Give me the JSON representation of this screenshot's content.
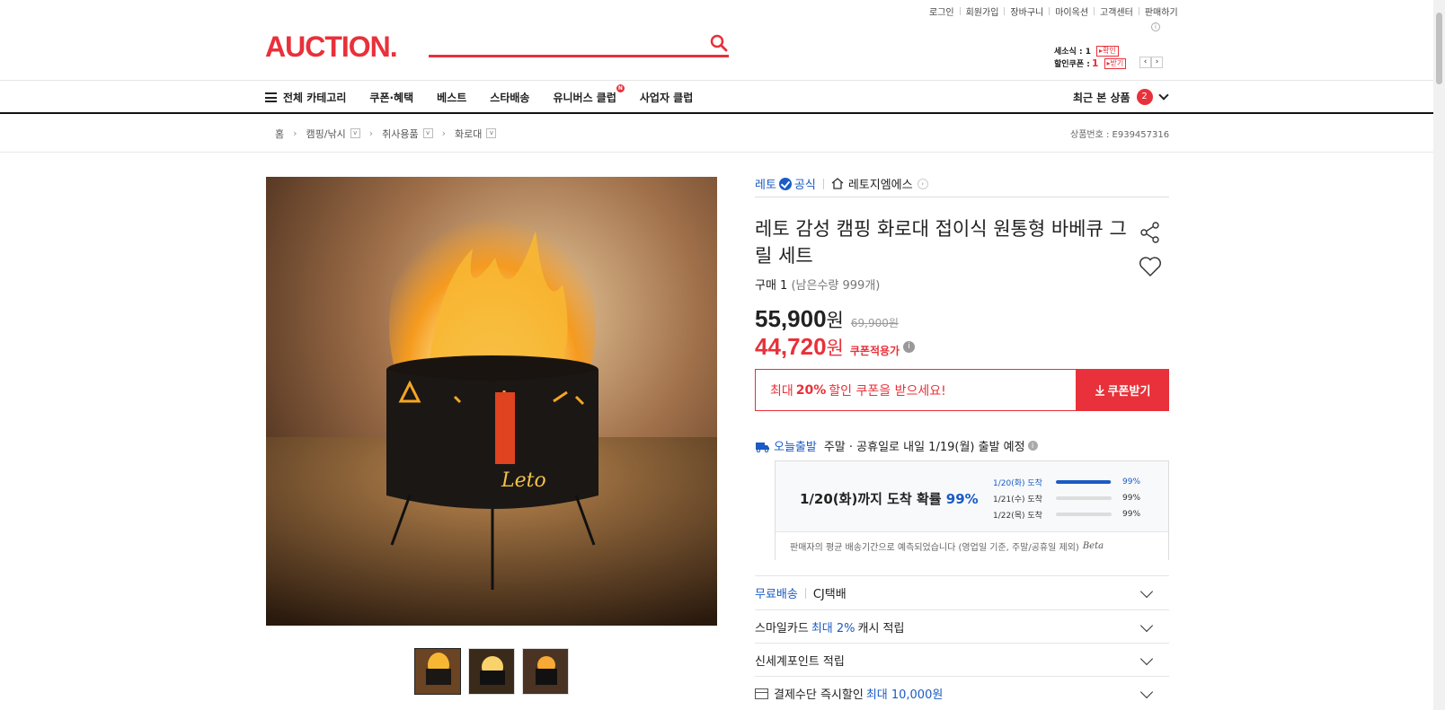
{
  "util_links": [
    "로그인",
    "회원가입",
    "장바구니",
    "마이옥션",
    "고객센터",
    "판매하기"
  ],
  "logo": "AUCTION.",
  "search": {
    "placeholder": ""
  },
  "mini": {
    "seat_label": "세소식 : 1",
    "seat_btn": "▸확인",
    "coupon_label": "할인쿠폰 :",
    "coupon_count": "1",
    "coupon_btn": "▸받기"
  },
  "nav": {
    "all_category": "전체 카테고리",
    "items": [
      "쿠폰·혜택",
      "베스트",
      "스타배송",
      "유니버스 클럽",
      "사업자 클럽"
    ],
    "universe_badge": "N",
    "recent_label": "최근 본 상품",
    "recent_count": "2"
  },
  "breadcrumb": [
    "홈",
    "캠핑/낚시",
    "취사용품",
    "화로대"
  ],
  "product_no": "상품번호 : E939457316",
  "seller": {
    "brand": "레토",
    "official": "공식",
    "store": "레토지엠에스"
  },
  "title": "레토 감성 캠핑 화로대 접이식 원통형 바베큐 그릴 세트",
  "purchase": {
    "label": "구매 1",
    "remain": "(남은수량 999개)"
  },
  "price": {
    "sale": "55,900",
    "won": "원",
    "original": "69,900원",
    "coupon_price": "44,720",
    "coupon_label": "쿠폰적용가"
  },
  "coupon_banner": {
    "prefix": "최대",
    "percent": "20%",
    "suffix": "할인 쿠폰을 받으세요!",
    "button": "쿠폰받기"
  },
  "shipping": {
    "tag": "오늘출발",
    "text": "주말 · 공휴일로 내일 1/19(월) 출발 예정"
  },
  "arrival": {
    "headline": "1/20(화)까지 도착 확률",
    "headline_pct": "99%",
    "rows": [
      {
        "date": "1/20(화) 도착",
        "pct": "99%",
        "level": 0.99
      },
      {
        "date": "1/21(수) 도착",
        "pct": "99%",
        "level": 0
      },
      {
        "date": "1/22(목) 도착",
        "pct": "99%",
        "level": 0
      }
    ],
    "note": "판매자의 평균 배송기간으로 예측되었습니다 (영업일 기준, 주말/공휴일 제외)",
    "beta": "Beta"
  },
  "accordions": {
    "delivery_free": "무료배송",
    "delivery_carrier": "CJ택배",
    "smilecard_a": "스마일카드",
    "smilecard_b": "최대 2%",
    "smilecard_c": "캐시 적립",
    "shinsegae": "신세계포인트 적립",
    "pay_a": "결제수단 즉시할인",
    "pay_b": "최대 10,000원"
  },
  "colors": {
    "brand": "#e8313a",
    "blue": "#1a5bc4"
  },
  "icons": [
    "search-icon",
    "menu-icon",
    "chevron-down-icon",
    "verified-icon",
    "home-icon",
    "share-icon",
    "heart-icon",
    "download-icon",
    "truck-icon",
    "info-icon",
    "card-icon"
  ]
}
